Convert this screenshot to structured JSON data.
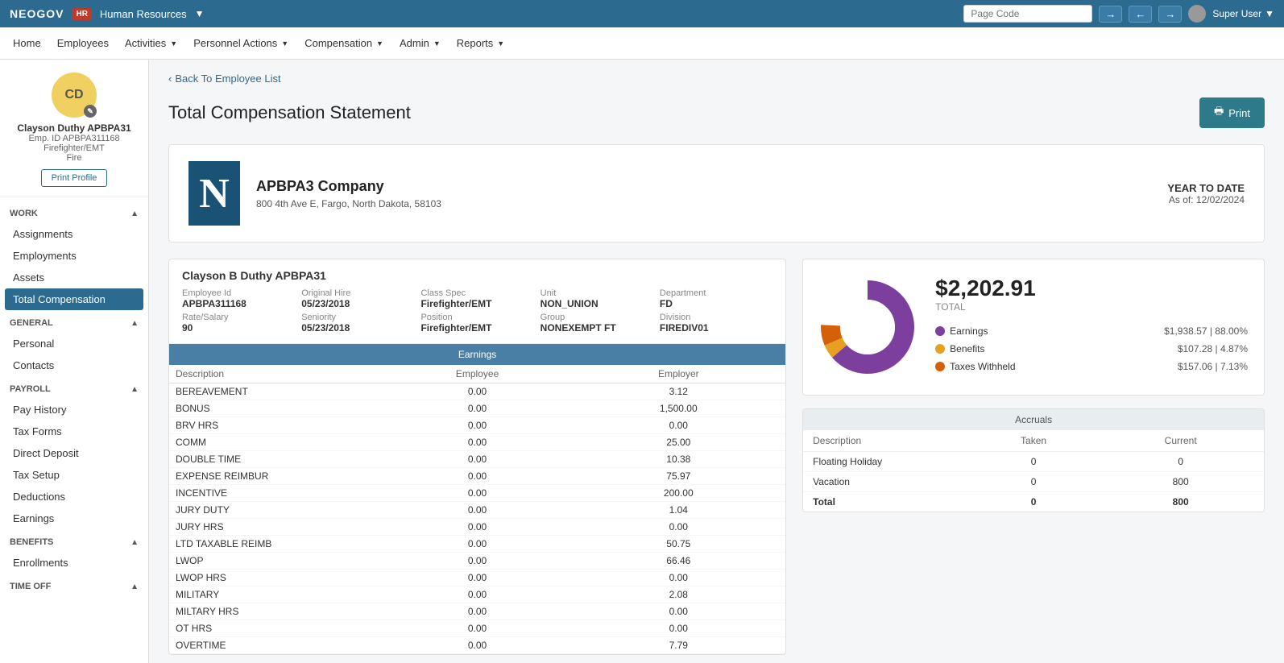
{
  "topbar": {
    "logo": "NEOGOV",
    "hr_badge": "HR",
    "app_name": "Human Resources",
    "page_code_placeholder": "Page Code",
    "user_label": "Super User"
  },
  "mainnav": {
    "items": [
      {
        "label": "Home"
      },
      {
        "label": "Employees"
      },
      {
        "label": "Activities",
        "has_dropdown": true
      },
      {
        "label": "Personnel Actions",
        "has_dropdown": true
      },
      {
        "label": "Compensation",
        "has_dropdown": true
      },
      {
        "label": "Admin",
        "has_dropdown": true
      },
      {
        "label": "Reports",
        "has_dropdown": true
      }
    ]
  },
  "sidebar": {
    "profile": {
      "initials": "CD",
      "name": "Clayson Duthy APBPA31",
      "emp_id": "Emp. ID APBPA311168",
      "role": "Firefighter/EMT",
      "dept": "Fire",
      "print_label": "Print Profile"
    },
    "sections": [
      {
        "title": "WORK",
        "items": [
          {
            "label": "Assignments"
          },
          {
            "label": "Employments"
          },
          {
            "label": "Assets"
          },
          {
            "label": "Total Compensation",
            "active": true
          }
        ]
      },
      {
        "title": "GENERAL",
        "items": [
          {
            "label": "Personal"
          },
          {
            "label": "Contacts"
          }
        ]
      },
      {
        "title": "PAYROLL",
        "items": [
          {
            "label": "Pay History"
          },
          {
            "label": "Tax Forms"
          },
          {
            "label": "Direct Deposit"
          },
          {
            "label": "Tax Setup"
          },
          {
            "label": "Deductions"
          },
          {
            "label": "Earnings"
          }
        ]
      },
      {
        "title": "BENEFITS",
        "items": [
          {
            "label": "Enrollments"
          }
        ]
      },
      {
        "title": "TIME OFF",
        "items": []
      }
    ]
  },
  "back_link": "Back To Employee List",
  "page_title": "Total Compensation Statement",
  "print_btn": "Print",
  "company": {
    "logo_letter": "N",
    "name": "APBPA3 Company",
    "address": "800 4th Ave E, Fargo, North Dakota, 58103",
    "ytd_label": "YEAR TO DATE",
    "ytd_date": "As of: 12/02/2024"
  },
  "employee": {
    "name": "Clayson B Duthy APBPA31",
    "fields": [
      {
        "label": "Employee Id",
        "value": "APBPA311168"
      },
      {
        "label": "Original Hire",
        "value": "05/23/2018"
      },
      {
        "label": "Class Spec",
        "value": "Firefighter/EMT"
      },
      {
        "label": "Unit",
        "value": "NON_UNION"
      },
      {
        "label": "Department",
        "value": "FD"
      },
      {
        "label": "Rate/Salary",
        "value": "90"
      },
      {
        "label": "Seniority",
        "value": "05/23/2018"
      },
      {
        "label": "Position",
        "value": "Firefighter/EMT"
      },
      {
        "label": "Group",
        "value": "NONEXEMPT FT"
      },
      {
        "label": "Division",
        "value": "FIREDIV01"
      }
    ]
  },
  "earnings_table": {
    "section_label": "Earnings",
    "col_description": "Description",
    "col_employee": "Employee",
    "col_employer": "Employer",
    "rows": [
      {
        "description": "BEREAVEMENT",
        "employee": "0.00",
        "employer": "3.12"
      },
      {
        "description": "BONUS",
        "employee": "0.00",
        "employer": "1,500.00"
      },
      {
        "description": "BRV HRS",
        "employee": "0.00",
        "employer": "0.00"
      },
      {
        "description": "COMM",
        "employee": "0.00",
        "employer": "25.00"
      },
      {
        "description": "DOUBLE TIME",
        "employee": "0.00",
        "employer": "10.38"
      },
      {
        "description": "EXPENSE REIMBUR",
        "employee": "0.00",
        "employer": "75.97"
      },
      {
        "description": "INCENTIVE",
        "employee": "0.00",
        "employer": "200.00"
      },
      {
        "description": "JURY DUTY",
        "employee": "0.00",
        "employer": "1.04"
      },
      {
        "description": "JURY HRS",
        "employee": "0.00",
        "employer": "0.00"
      },
      {
        "description": "LTD TAXABLE REIMB",
        "employee": "0.00",
        "employer": "50.75"
      },
      {
        "description": "LWOP",
        "employee": "0.00",
        "employer": "66.46"
      },
      {
        "description": "LWOP HRS",
        "employee": "0.00",
        "employer": "0.00"
      },
      {
        "description": "MILITARY",
        "employee": "0.00",
        "employer": "2.08"
      },
      {
        "description": "MILTARY HRS",
        "employee": "0.00",
        "employer": "0.00"
      },
      {
        "description": "OT HRS",
        "employee": "0.00",
        "employer": "0.00"
      },
      {
        "description": "OVERTIME",
        "employee": "0.00",
        "employer": "7.79"
      }
    ]
  },
  "chart": {
    "total_amount": "$2,202.91",
    "total_label": "TOTAL",
    "legend": [
      {
        "label": "Earnings",
        "value": "$1,938.57 | 88.00%",
        "color": "#7c3f9e"
      },
      {
        "label": "Benefits",
        "value": "$107.28 | 4.87%",
        "color": "#e8a020"
      },
      {
        "label": "Taxes Withheld",
        "value": "$157.06 | 7.13%",
        "color": "#d4600a"
      }
    ],
    "donut": {
      "earnings_pct": 88,
      "benefits_pct": 4.87,
      "taxes_pct": 7.13
    }
  },
  "accruals": {
    "header": "Accruals",
    "col_description": "Description",
    "col_taken": "Taken",
    "col_current": "Current",
    "rows": [
      {
        "description": "Floating Holiday",
        "taken": "0",
        "current": "0"
      },
      {
        "description": "Vacation",
        "taken": "0",
        "current": "800"
      }
    ],
    "total_row": {
      "description": "Total",
      "taken": "0",
      "current": "800"
    }
  }
}
